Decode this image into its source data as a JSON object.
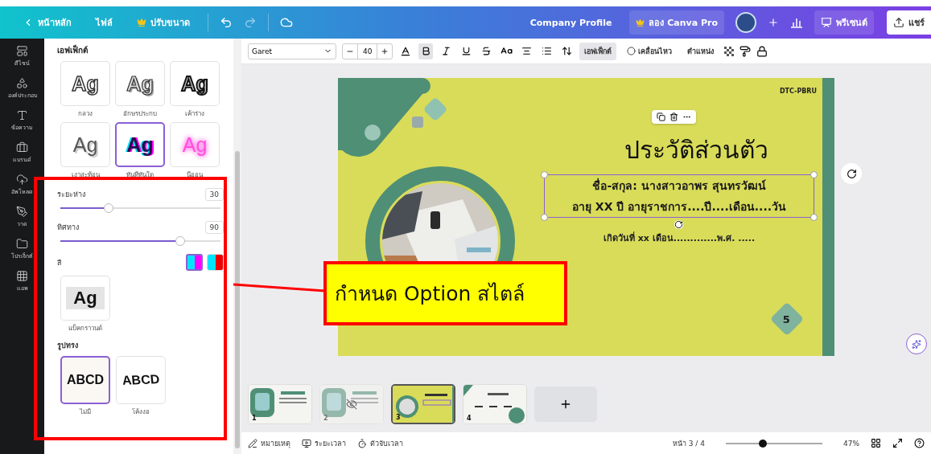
{
  "topbar": {
    "back": "หน้าหลัก",
    "menu": [
      {
        "label": "ไฟล์",
        "pro": false
      },
      {
        "label": "ปรับขนาด",
        "pro": true
      }
    ],
    "project_title": "Company Profile",
    "pro_button": "ลอง Canva Pro",
    "present_button": "พรีเซนต์",
    "share_button": "แชร์"
  },
  "rail": [
    {
      "label": "ดีไซน์",
      "kind": "design"
    },
    {
      "label": "องค์ประกอบ",
      "kind": "elements"
    },
    {
      "label": "ข้อความ",
      "kind": "text"
    },
    {
      "label": "แบรนด์",
      "kind": "brand"
    },
    {
      "label": "อัพโหลด",
      "kind": "upload"
    },
    {
      "label": "วาด",
      "kind": "draw"
    },
    {
      "label": "โปรเจ็กต์",
      "kind": "projects"
    },
    {
      "label": "แอพ",
      "kind": "apps"
    }
  ],
  "panel": {
    "title": "เอฟเฟ็กต์",
    "effects": [
      {
        "label": "กลวง",
        "sample": "Ag",
        "kind": "hollow",
        "selected": false
      },
      {
        "label": "อักษรประกบ",
        "sample": "Ag",
        "kind": "splice",
        "selected": false
      },
      {
        "label": "เค้าร่าง",
        "sample": "Ag",
        "kind": "outline",
        "selected": false
      },
      {
        "label": "เงาสะท้อน",
        "sample": "Ag",
        "kind": "echo",
        "selected": false
      },
      {
        "label": "ทันทีทันใด",
        "sample": "Ag",
        "kind": "glitch",
        "selected": true
      },
      {
        "label": "นีออน",
        "sample": "Ag",
        "kind": "neon",
        "selected": false
      }
    ],
    "spacing": {
      "label": "ระยะห่าง",
      "value": "30",
      "level": 0.3
    },
    "direction": {
      "label": "ทิศทาง",
      "value": "90",
      "level": 0.75
    },
    "color": {
      "label": "สี",
      "swatches": [
        {
          "color": "#ff00ff",
          "selected": true
        },
        {
          "color": "#ee0000",
          "selected": false
        }
      ]
    },
    "background": {
      "label": "แบ็คกราวนด์",
      "sample": "Ag"
    },
    "shape": {
      "title": "รูปทรง",
      "options": [
        {
          "label": "ไม่มี",
          "sample": "ABCD",
          "kind": "straight",
          "selected": true
        },
        {
          "label": "โค้งงอ",
          "sample": "ABCD",
          "kind": "curve",
          "selected": false
        }
      ]
    }
  },
  "toolbar": {
    "font": "Garet",
    "size": "40",
    "bold": true,
    "effects": {
      "label": "เอฟเฟ็กต์",
      "selected": true
    },
    "animate": "เคลื่อนไหว",
    "position": "ตำแหน่ง"
  },
  "slide": {
    "tag": "DTC-PBRU",
    "title": "ประวัติส่วนตัว",
    "lines": [
      "ชื่อ-สกุล: นางสาวอาพร สุนทรวัฒน์",
      "อายุ  XX  ปี อายุราชการ....ปี....เดือน....วัน"
    ],
    "birth_line": "เกิดวันที่ xx เดือน.............พ.ศ. .....",
    "page_number": "5"
  },
  "thumbnails": [
    {
      "number": "1",
      "selected": false,
      "hidden": false,
      "kind": "green"
    },
    {
      "number": "2",
      "selected": false,
      "hidden": true,
      "kind": "green"
    },
    {
      "number": "3",
      "selected": true,
      "hidden": false,
      "kind": "yellow"
    },
    {
      "number": "4",
      "selected": false,
      "hidden": false,
      "kind": "list"
    }
  ],
  "bottom": {
    "notes": "หมายเหตุ",
    "duration": "ระยะเวลา",
    "timer": "ตัวจับเวลา",
    "page": "หน้า 3 / 4",
    "zoom": {
      "level": 0.38,
      "reading": "47%"
    }
  },
  "annotation": {
    "text": "กำหนด Option สไตล์"
  }
}
